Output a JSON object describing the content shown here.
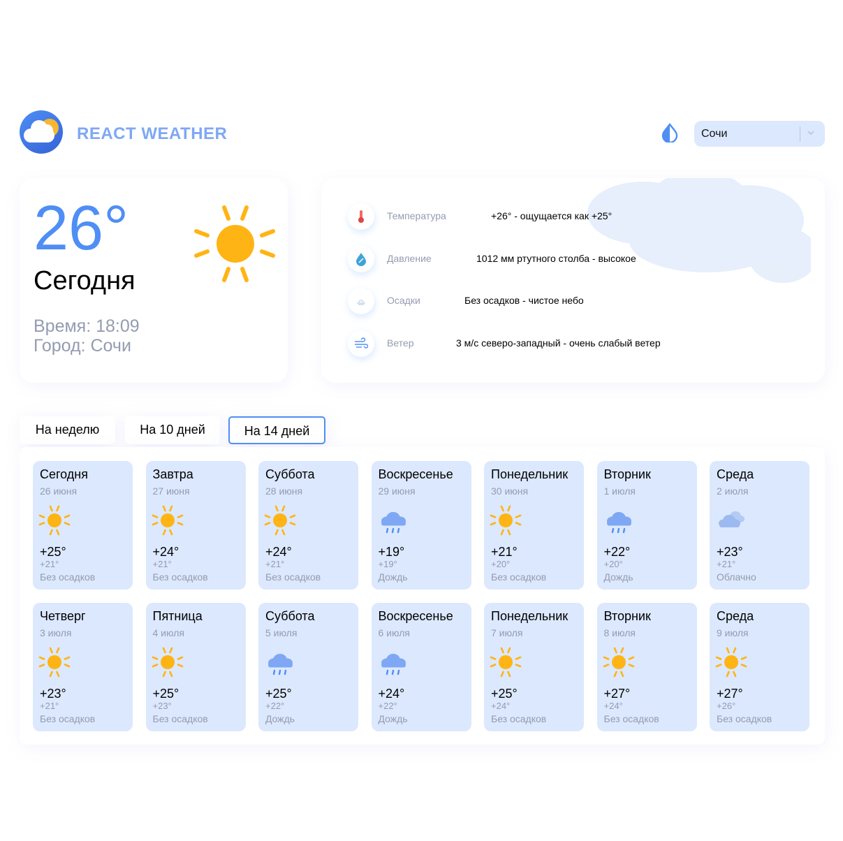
{
  "header": {
    "title": "REACT WEATHER",
    "city_select": {
      "value": "Сочи"
    }
  },
  "today": {
    "temp": "26°",
    "label": "Сегодня",
    "time": "Время: 18:09",
    "city": "Город: Сочи",
    "icon": "sun-icon"
  },
  "details": {
    "temperature": {
      "label": "Температура",
      "value": "+26° - ощущается как +25°",
      "icon": "thermometer-icon"
    },
    "pressure": {
      "label": "Давление",
      "value": "1012 мм ртутного столба - высокое",
      "icon": "pressure-drop-icon"
    },
    "precipitation": {
      "label": "Осадки",
      "value": "Без осадков - чистое небо",
      "icon": "precipitation-icon"
    },
    "wind": {
      "label": "Ветер",
      "value": "3 м/с северо-западный - очень слабый ветер",
      "icon": "wind-icon"
    }
  },
  "tabs": [
    {
      "label": "На неделю",
      "active": false
    },
    {
      "label": "На 10 дней",
      "active": false
    },
    {
      "label": "На 14 дней",
      "active": true
    }
  ],
  "forecast": [
    {
      "day": "Сегодня",
      "date": "26 июня",
      "icon": "sun",
      "max": "+25°",
      "min": "+21°",
      "desc": "Без осадков"
    },
    {
      "day": "Завтра",
      "date": "27 июня",
      "icon": "sun",
      "max": "+24°",
      "min": "+21°",
      "desc": "Без осадков"
    },
    {
      "day": "Суббота",
      "date": "28 июня",
      "icon": "sun",
      "max": "+24°",
      "min": "+21°",
      "desc": "Без осадков"
    },
    {
      "day": "Воскресенье",
      "date": "29 июня",
      "icon": "rain",
      "max": "+19°",
      "min": "+19°",
      "desc": "Дождь"
    },
    {
      "day": "Понедельник",
      "date": "30 июня",
      "icon": "sun",
      "max": "+21°",
      "min": "+20°",
      "desc": "Без осадков"
    },
    {
      "day": "Вторник",
      "date": "1 июля",
      "icon": "rain",
      "max": "+22°",
      "min": "+20°",
      "desc": "Дождь"
    },
    {
      "day": "Среда",
      "date": "2 июля",
      "icon": "cloud",
      "max": "+23°",
      "min": "+21°",
      "desc": "Облачно"
    },
    {
      "day": "Четверг",
      "date": "3 июля",
      "icon": "sun",
      "max": "+23°",
      "min": "+21°",
      "desc": "Без осадков"
    },
    {
      "day": "Пятница",
      "date": "4 июля",
      "icon": "sun",
      "max": "+25°",
      "min": "+23°",
      "desc": "Без осадков"
    },
    {
      "day": "Суббота",
      "date": "5 июля",
      "icon": "rain",
      "max": "+25°",
      "min": "+22°",
      "desc": "Дождь"
    },
    {
      "day": "Воскресенье",
      "date": "6 июля",
      "icon": "rain",
      "max": "+24°",
      "min": "+22°",
      "desc": "Дождь"
    },
    {
      "day": "Понедельник",
      "date": "7 июля",
      "icon": "sun",
      "max": "+25°",
      "min": "+24°",
      "desc": "Без осадков"
    },
    {
      "day": "Вторник",
      "date": "8 июля",
      "icon": "sun",
      "max": "+27°",
      "min": "+24°",
      "desc": "Без осадков"
    },
    {
      "day": "Среда",
      "date": "9 июля",
      "icon": "sun",
      "max": "+27°",
      "min": "+26°",
      "desc": "Без осадков"
    }
  ],
  "colors": {
    "accent": "#4f8ef5",
    "title": "#7fa8f4",
    "card_bg": "#dce8fd",
    "muted_text": "#939cb0",
    "sun": "#ffb415",
    "rain_cloud": "#7fa8f4"
  }
}
